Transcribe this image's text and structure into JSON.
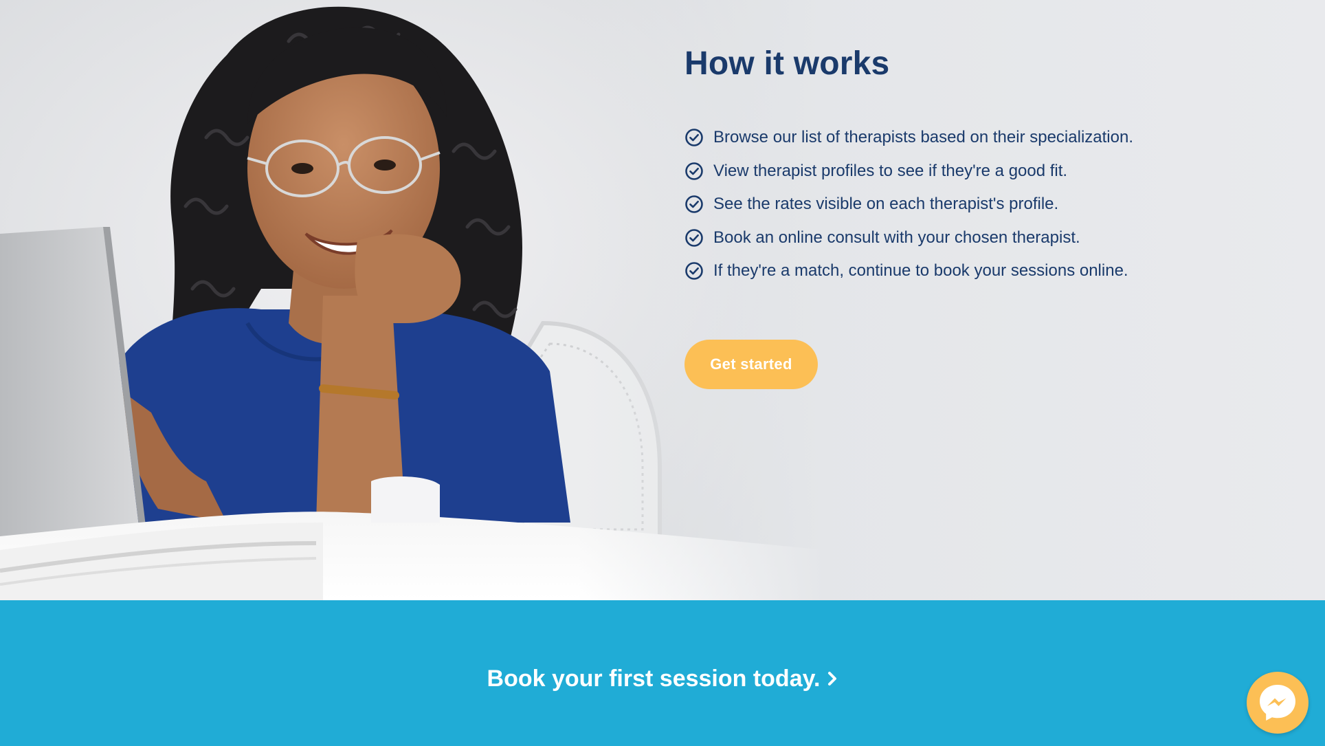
{
  "hero": {
    "title": "How it works",
    "steps": [
      "Browse our list of therapists based on their specialization.",
      "View therapist profiles to see if they're a good fit.",
      "See the rates visible on each therapist's profile.",
      "Book an online consult with your chosen therapist.",
      "If they're a match, continue to book your sessions online."
    ],
    "step_icon": "check-circle-icon",
    "cta_label": "Get started"
  },
  "banner": {
    "link_text": "Book your first session today.",
    "link_icon": "chevron-right-icon"
  },
  "chat_widget": {
    "icon": "messenger-icon"
  },
  "colors": {
    "heading": "#1a3a6b",
    "cta_background": "#fcbf55",
    "banner_background": "#20acd6",
    "banner_text": "#ffffff"
  }
}
